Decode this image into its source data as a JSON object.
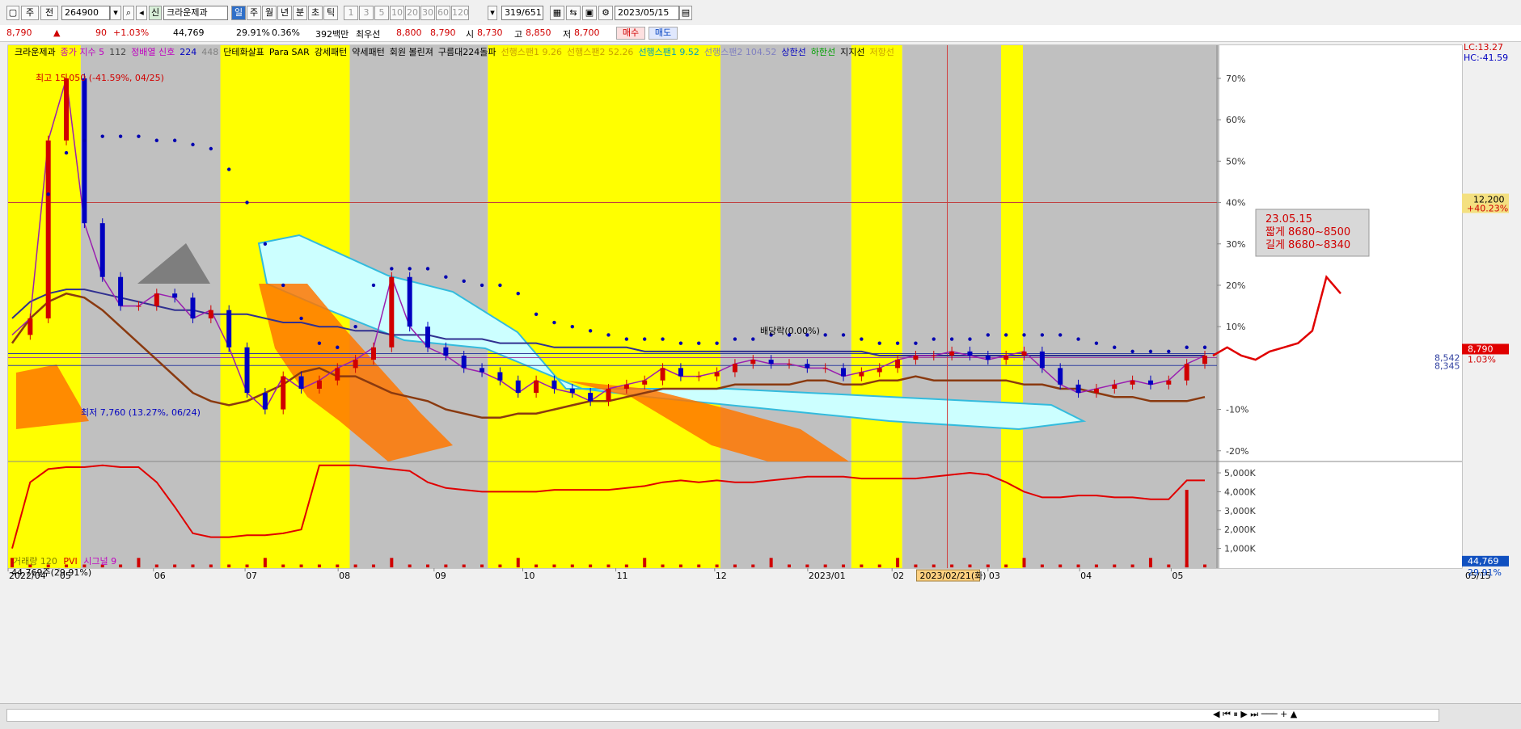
{
  "toolbar": {
    "period_prefix": "주",
    "period_all": "전",
    "code": "264900",
    "name": "크라운제과",
    "periods": [
      "일",
      "주",
      "월",
      "년",
      "분",
      "초",
      "틱"
    ],
    "intervals": [
      "1",
      "3",
      "5",
      "10",
      "20",
      "30",
      "60",
      "120"
    ],
    "count": "319/651",
    "date": "2023/05/15"
  },
  "quote": {
    "price": "8,790",
    "change": "90",
    "change_pct": "+1.03%",
    "volume": "44,769",
    "volume_ratio": "29.91%",
    "turnover_pct": "0.36%",
    "amount": "392백만",
    "best_label": "최우선",
    "best_ask": "8,800",
    "best_bid": "8,790",
    "open_label": "시",
    "open": "8,730",
    "high_label": "고",
    "high": "8,850",
    "low_label": "저",
    "low": "8,700",
    "buy": "매수",
    "sell": "매도"
  },
  "legend": [
    {
      "text": "크라운제과",
      "color": "#000000"
    },
    {
      "text": "종가 지수 5",
      "color": "#c000c0"
    },
    {
      "text": "112",
      "color": "#444444"
    },
    {
      "text": "정배열 신호",
      "color": "#c000c0"
    },
    {
      "text": "224",
      "color": "#0000c0"
    },
    {
      "text": "448",
      "color": "#808080"
    },
    {
      "text": "단테화살표",
      "color": "#000000"
    },
    {
      "text": "Para SAR",
      "color": "#000000"
    },
    {
      "text": "강세패턴",
      "color": "#000000"
    },
    {
      "text": "약세패턴",
      "color": "#000000"
    },
    {
      "text": "회원 볼린져",
      "color": "#000000"
    },
    {
      "text": "구름대224돌파",
      "color": "#000000"
    },
    {
      "text": "선행스팬1 9.26",
      "color": "#c8a000"
    },
    {
      "text": "선행스팬2 52.26",
      "color": "#c8a000"
    },
    {
      "text": "선행스팬1 9.52",
      "color": "#00a0c0"
    },
    {
      "text": "선행스팬2 104.52",
      "color": "#8080c0"
    },
    {
      "text": "상한선",
      "color": "#0000c0"
    },
    {
      "text": "하한선",
      "color": "#00a000"
    },
    {
      "text": "지지선",
      "color": "#000000"
    },
    {
      "text": "저항선",
      "color": "#c8a000"
    }
  ],
  "annotations": {
    "high": "최고 15,050 (-41.59%, 04/25)",
    "low": "최저 7,760 (13.27%, 06/24)",
    "dividend": "배당락(0.00%)",
    "note_date": "23.05.15",
    "note_short": "짧게 8680~8500",
    "note_long": "길게 8680~8340",
    "cursor_date": "2023/02/21(화)",
    "lc": "LC:13.27",
    "hc": "HC:-41.59",
    "hline_price": "12,200",
    "hline_pct": "+40.23%",
    "cur_price": "8,790",
    "cur_pct": "1.03%",
    "level1": "8,542",
    "level2": "8,345",
    "vol_label": "거래량",
    "vol_period": "120",
    "pvi_label": "PVI",
    "signal_label": "시그널 9",
    "vol_value": "44,769주(29.91%)",
    "vol_badge": "44,769",
    "vol_pct": "29.91%",
    "right_date": "05/15"
  },
  "chart_data": {
    "type": "line",
    "title": "크라운제과",
    "y_axis_pct_ticks": [
      "70%",
      "60%",
      "50%",
      "40%",
      "30%",
      "20%",
      "10%",
      "-10%",
      "-20%"
    ],
    "volume_axis_ticks": [
      "5,000K",
      "4,000K",
      "3,000K",
      "2,000K",
      "1,000K"
    ],
    "x_ticks": [
      "2022/04",
      "05",
      "06",
      "07",
      "08",
      "09",
      "10",
      "11",
      "12",
      "2023/01",
      "02",
      "03",
      "04",
      "05"
    ],
    "x_tick_pos": [
      0.0,
      0.035,
      0.1,
      0.163,
      0.227,
      0.293,
      0.354,
      0.418,
      0.486,
      0.55,
      0.608,
      0.674,
      0.737,
      0.8
    ],
    "price_ylim": [
      -22,
      78
    ],
    "close_pct": [
      8,
      12,
      55,
      70,
      35,
      22,
      15,
      15,
      18,
      17,
      12,
      14,
      5,
      -6,
      -10,
      -2,
      -5,
      -3,
      0,
      2,
      5,
      22,
      10,
      5,
      3,
      0,
      -1,
      -3,
      -6,
      -3,
      -5,
      -6,
      -8,
      -5,
      -4,
      -3,
      0,
      -2,
      -2,
      -1,
      1,
      2,
      1,
      1,
      0,
      0,
      -2,
      -1,
      0,
      2,
      3,
      3,
      4,
      3,
      2,
      3,
      4,
      0,
      -4,
      -6,
      -5,
      -4,
      -3,
      -4,
      -3,
      1,
      3
    ],
    "ma_long_pct": [
      12,
      16,
      18,
      19,
      19,
      18,
      17,
      16,
      15,
      14,
      14,
      13,
      13,
      13,
      12,
      11,
      11,
      10,
      10,
      9,
      9,
      8,
      8,
      8,
      7,
      7,
      7,
      6,
      6,
      6,
      5,
      5,
      5,
      5,
      5,
      4,
      4,
      4,
      4,
      4,
      4,
      4,
      4,
      4,
      4,
      4,
      4,
      4,
      3,
      3,
      3,
      3,
      3,
      3,
      3,
      3,
      3,
      3,
      3,
      3,
      3,
      3,
      3,
      3,
      3,
      3,
      3
    ],
    "ma_mid_pct": [
      6,
      12,
      16,
      18,
      17,
      14,
      10,
      6,
      2,
      -2,
      -6,
      -8,
      -9,
      -8,
      -6,
      -4,
      -1,
      0,
      -2,
      -2,
      -4,
      -6,
      -7,
      -8,
      -10,
      -11,
      -12,
      -12,
      -11,
      -11,
      -10,
      -9,
      -8,
      -8,
      -7,
      -6,
      -5,
      -5,
      -5,
      -5,
      -4,
      -4,
      -4,
      -4,
      -3,
      -3,
      -4,
      -4,
      -3,
      -3,
      -2,
      -3,
      -3,
      -3,
      -3,
      -3,
      -4,
      -4,
      -5,
      -5,
      -6,
      -7,
      -7,
      -8,
      -8,
      -8,
      -7
    ],
    "sar_pct": [
      null,
      null,
      42,
      52,
      55,
      56,
      56,
      56,
      55,
      55,
      54,
      53,
      48,
      40,
      30,
      20,
      12,
      6,
      5,
      10,
      20,
      24,
      24,
      24,
      22,
      21,
      20,
      20,
      18,
      13,
      11,
      10,
      9,
      8,
      7,
      7,
      7,
      6,
      6,
      6,
      7,
      7,
      8,
      8,
      8,
      8,
      8,
      7,
      6,
      6,
      6,
      7,
      7,
      7,
      8,
      8,
      8,
      8,
      8,
      7,
      6,
      5,
      4,
      4,
      4,
      5,
      5
    ],
    "pvi": [
      1.0,
      4.5,
      5.2,
      5.3,
      5.3,
      5.4,
      5.3,
      5.3,
      4.5,
      3.2,
      1.8,
      1.6,
      1.6,
      1.7,
      1.7,
      1.8,
      2.0,
      5.4,
      5.4,
      5.4,
      5.3,
      5.2,
      5.1,
      4.5,
      4.2,
      4.1,
      4.0,
      4.0,
      4.0,
      4.0,
      4.1,
      4.1,
      4.1,
      4.1,
      4.2,
      4.3,
      4.5,
      4.6,
      4.5,
      4.6,
      4.5,
      4.5,
      4.6,
      4.7,
      4.8,
      4.8,
      4.8,
      4.7,
      4.7,
      4.7,
      4.7,
      4.8,
      4.9,
      5.0,
      4.9,
      4.5,
      4.0,
      3.7,
      3.7,
      3.8,
      3.8,
      3.7,
      3.7,
      3.6,
      3.6,
      4.6,
      4.6
    ],
    "projection_pct": [
      3,
      5,
      3,
      2,
      4,
      5,
      6,
      9,
      22,
      18
    ],
    "vol_ylim": [
      0,
      5.6
    ]
  }
}
